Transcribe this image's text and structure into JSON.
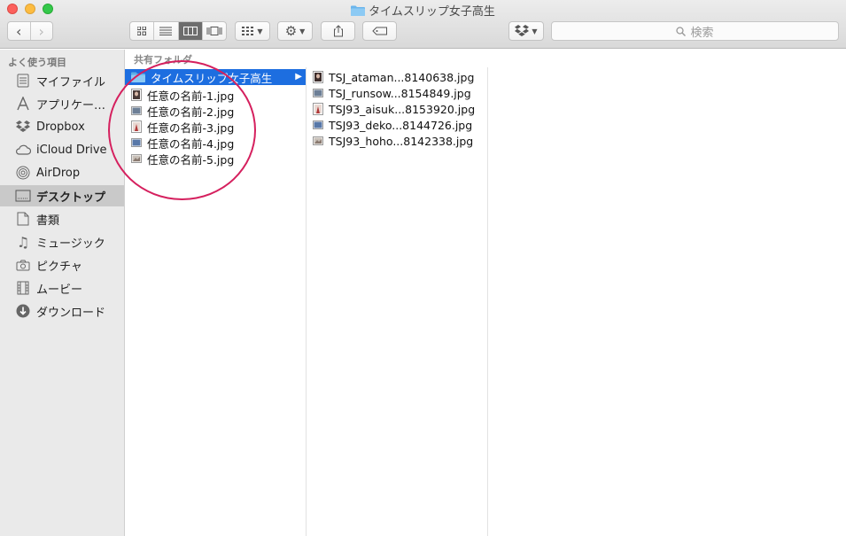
{
  "window": {
    "title": "タイムスリップ女子高生"
  },
  "toolbar": {
    "search_placeholder": "検索"
  },
  "sidebar": {
    "heading": "よく使う項目",
    "items": [
      {
        "label": "マイファイル",
        "icon": "all-files-icon"
      },
      {
        "label": "アプリケー…",
        "icon": "applications-icon"
      },
      {
        "label": "Dropbox",
        "icon": "dropbox-icon"
      },
      {
        "label": "iCloud Drive",
        "icon": "cloud-icon"
      },
      {
        "label": "AirDrop",
        "icon": "airdrop-icon"
      },
      {
        "label": "デスクトップ",
        "icon": "desktop-icon",
        "selected": true
      },
      {
        "label": "書類",
        "icon": "documents-icon"
      },
      {
        "label": "ミュージック",
        "icon": "music-icon"
      },
      {
        "label": "ピクチャ",
        "icon": "camera-icon"
      },
      {
        "label": "ムービー",
        "icon": "film-icon"
      },
      {
        "label": "ダウンロード",
        "icon": "download-icon"
      }
    ]
  },
  "column_header": "共有フォルダ",
  "column1": [
    {
      "name": "タイムスリップ女子高生",
      "type": "folder",
      "selected": true
    },
    {
      "name": "任意の名前-1.jpg",
      "type": "image"
    },
    {
      "name": "任意の名前-2.jpg",
      "type": "image"
    },
    {
      "name": "任意の名前-3.jpg",
      "type": "image"
    },
    {
      "name": "任意の名前-4.jpg",
      "type": "image"
    },
    {
      "name": "任意の名前-5.jpg",
      "type": "image"
    }
  ],
  "column2": [
    {
      "name": "TSJ_ataman...8140638.jpg",
      "type": "image"
    },
    {
      "name": "TSJ_runsow...8154849.jpg",
      "type": "image"
    },
    {
      "name": "TSJ93_aisuk...8153920.jpg",
      "type": "image"
    },
    {
      "name": "TSJ93_deko...8144726.jpg",
      "type": "image"
    },
    {
      "name": "TSJ93_hoho...8142338.jpg",
      "type": "image"
    }
  ],
  "colors": {
    "accent": "#1d6ee0",
    "annotation_circle": "#d5205e"
  }
}
